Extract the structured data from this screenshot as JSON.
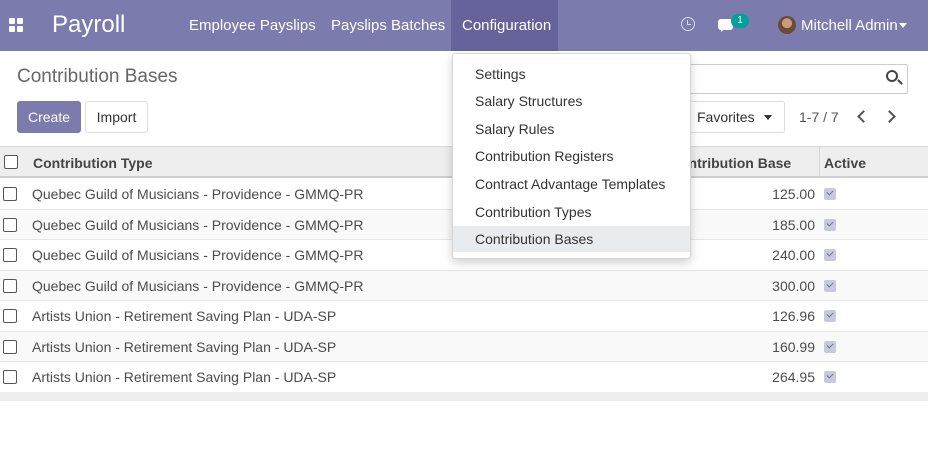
{
  "navbar": {
    "app_name": "Payroll",
    "menu": [
      "Employee Payslips",
      "Payslips Batches",
      "Configuration"
    ],
    "active_menu": "Configuration",
    "chat_badge": "1",
    "user_name": "Mitchell Admin"
  },
  "control_panel": {
    "title": "Contribution Bases",
    "create_label": "Create",
    "import_label": "Import",
    "favorites_label": "Favorites",
    "pager": "1-7 / 7"
  },
  "table": {
    "headers": {
      "type": "Contribution Type",
      "base": "ontribution Base",
      "active": "Active"
    },
    "rows": [
      {
        "type": "Quebec Guild of Musicians - Providence - GMMQ-PR",
        "base": "125.00",
        "active": true
      },
      {
        "type": "Quebec Guild of Musicians - Providence - GMMQ-PR",
        "base": "185.00",
        "active": true
      },
      {
        "type": "Quebec Guild of Musicians - Providence - GMMQ-PR",
        "base": "240.00",
        "active": true
      },
      {
        "type": "Quebec Guild of Musicians - Providence - GMMQ-PR",
        "base": "300.00",
        "active": true
      },
      {
        "type": "Artists Union - Retirement Saving Plan - UDA-SP",
        "base": "126.96",
        "active": true
      },
      {
        "type": "Artists Union - Retirement Saving Plan - UDA-SP",
        "base": "160.99",
        "active": true
      },
      {
        "type": "Artists Union - Retirement Saving Plan - UDA-SP",
        "base": "264.95",
        "active": true
      }
    ]
  },
  "dropdown": {
    "items": [
      "Settings",
      "Salary Structures",
      "Salary Rules",
      "Contribution Registers",
      "Contract Advantage Templates",
      "Contribution Types",
      "Contribution Bases"
    ],
    "selected": "Contribution Bases"
  },
  "colors": {
    "brand": "#7c7bad",
    "brand_active": "#65639a",
    "badge": "#00a09d"
  }
}
